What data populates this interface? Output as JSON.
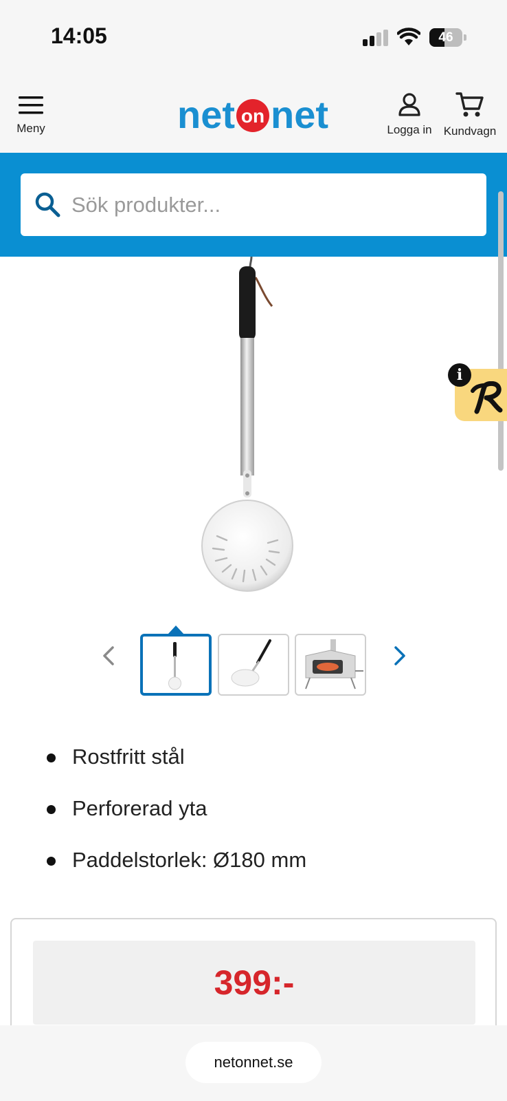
{
  "status_bar": {
    "time": "14:05",
    "battery_level": 46,
    "battery_text": "46",
    "signal_bars": 2,
    "signal_bars_total": 4
  },
  "header": {
    "menu_label": "Meny",
    "login_label": "Logga in",
    "cart_label": "Kundvagn",
    "logo": {
      "left": "net",
      "middle": "on",
      "right": "net"
    }
  },
  "search": {
    "placeholder": "Sök produkter..."
  },
  "gallery": {
    "thumbnail_count": 3,
    "active_index": 0,
    "thumbnails": [
      "pizza-peel-vertical",
      "pizza-peel-angled",
      "pizza-oven"
    ]
  },
  "features": [
    "Rostfritt stål",
    "Perforerad yta",
    "Paddelstorlek: Ø180 mm"
  ],
  "price": {
    "value": "399:-"
  },
  "browser": {
    "url": "netonnet.se"
  },
  "colors": {
    "brand_blue": "#0a8fd2",
    "logo_red": "#e3232b",
    "price_red": "#d6262b",
    "active_thumb": "#0a72b8"
  }
}
